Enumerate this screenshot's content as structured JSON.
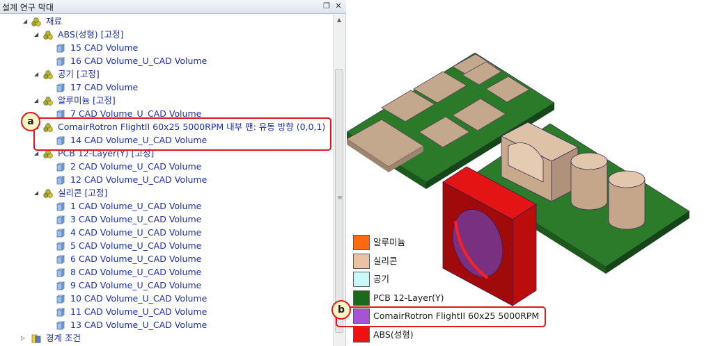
{
  "panel": {
    "title": "설계 연구 막대",
    "pin_icon": "pin-icon",
    "close_icon": "close-icon"
  },
  "tree": {
    "root_label": "재료",
    "groups": [
      {
        "label": "ABS(성형) [고정]",
        "children": [
          "15 CAD Volume",
          "16 CAD Volume_U_CAD Volume"
        ]
      },
      {
        "label": "공기 [고정]",
        "children": [
          "17 CAD Volume"
        ]
      },
      {
        "label": "알루미늄 [고정]",
        "children": [
          "7 CAD Volume_U_CAD Volume"
        ]
      },
      {
        "label": "ComairRotron FlightII 60x25 5000RPM 내부 팬: 유동 방향 (0,0,1)",
        "children": [
          "14 CAD Volume_U_CAD Volume"
        ]
      },
      {
        "label": "PCB 12-Layer(Y) [고정]",
        "children": [
          "2 CAD Volume_U_CAD Volume",
          "12 CAD Volume_U_CAD Volume"
        ]
      },
      {
        "label": "실리콘 [고정]",
        "children": [
          "1 CAD Volume_U_CAD Volume",
          "3 CAD Volume_U_CAD Volume",
          "4 CAD Volume_U_CAD Volume",
          "5 CAD Volume_U_CAD Volume",
          "6 CAD Volume_U_CAD Volume",
          "8 CAD Volume_U_CAD Volume",
          "9 CAD Volume_U_CAD Volume",
          "10 CAD Volume_U_CAD Volume",
          "11 CAD Volume_U_CAD Volume",
          "13 CAD Volume_U_CAD Volume"
        ]
      }
    ],
    "boundary_label": "경계 조건"
  },
  "callouts": {
    "a": "a",
    "b": "b"
  },
  "legend": [
    {
      "label": "알루미늄",
      "color": "#ff6a10"
    },
    {
      "label": "실리콘",
      "color": "#eac3a4"
    },
    {
      "label": "공기",
      "color": "#c8f8f8"
    },
    {
      "label": "PCB 12-Layer(Y)",
      "color": "#1a6a1a"
    },
    {
      "label": "ComairRotron FlightII 60x25 5000RPM",
      "color": "#a653d6"
    },
    {
      "label": "ABS(성형)",
      "color": "#ee1111"
    }
  ],
  "colors": {
    "tree_text": "#1a2fb3",
    "callout_red": "#e4141d",
    "pcb_green": "#1f6d22",
    "silicon_tan": "#dbbfa4",
    "abs_red": "#d40c0c"
  }
}
